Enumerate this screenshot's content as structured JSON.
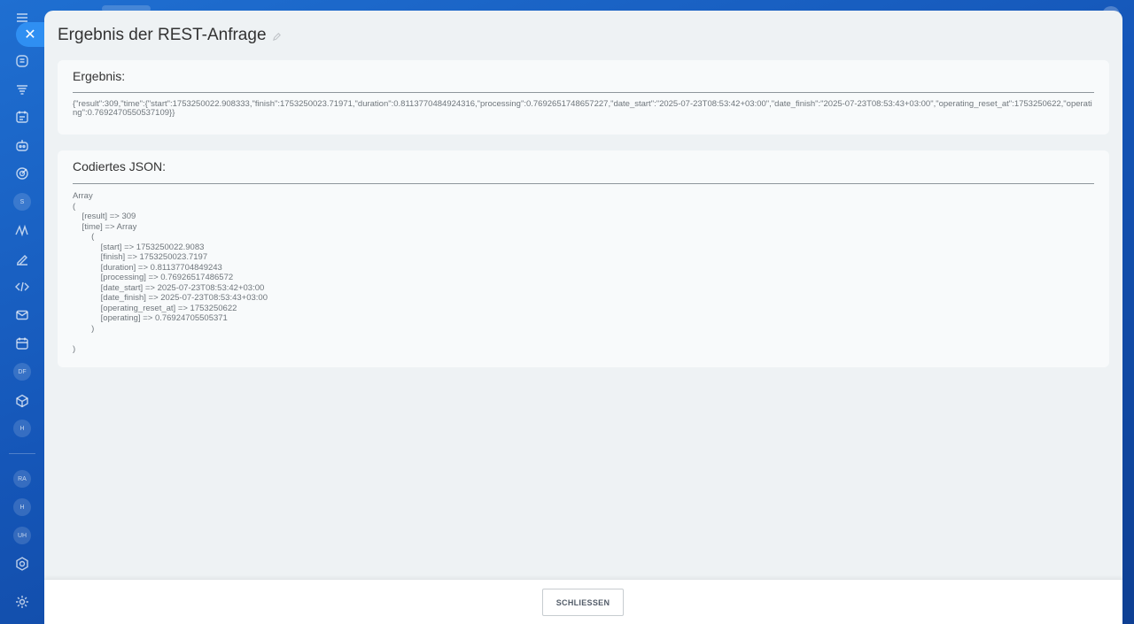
{
  "sidebar": {
    "close_icon": "close-icon",
    "avatars": [
      "S",
      "DF",
      "H",
      "RA",
      "H",
      "UH"
    ]
  },
  "panel": {
    "title": "Ergebnis der REST-Anfrage"
  },
  "result_card": {
    "heading": "Ergebnis:",
    "text": "{\"result\":309,\"time\":{\"start\":1753250022.908333,\"finish\":1753250023.71971,\"duration\":0.8113770484924316,\"processing\":0.7692651748657227,\"date_start\":\"2025-07-23T08:53:42+03:00\",\"date_finish\":\"2025-07-23T08:53:43+03:00\",\"operating_reset_at\":1753250622,\"operating\":0.7692470550537109}}"
  },
  "json_card": {
    "heading": "Codiertes JSON:",
    "text": "Array\n(\n    [result] => 309\n    [time] => Array\n        (\n            [start] => 1753250022.9083\n            [finish] => 1753250023.7197\n            [duration] => 0.81137704849243\n            [processing] => 0.76926517486572\n            [date_start] => 2025-07-23T08:53:42+03:00\n            [date_finish] => 2025-07-23T08:53:43+03:00\n            [operating_reset_at] => 1753250622\n            [operating] => 0.76924705505371\n        )\n\n)"
  },
  "footer": {
    "close_label": "SCHLIESSEN"
  }
}
